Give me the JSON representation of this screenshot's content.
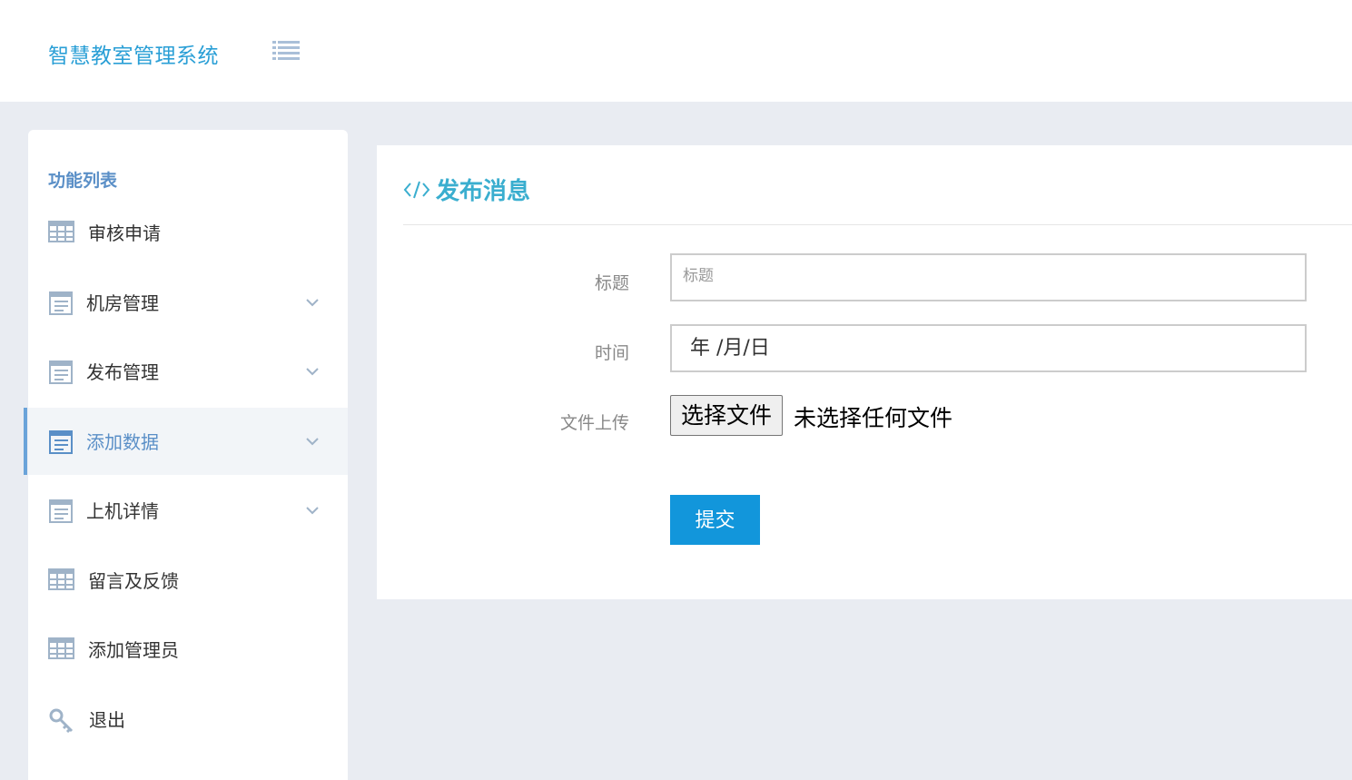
{
  "header": {
    "app_title": "智慧教室管理系统",
    "menu_toggle_icon": "list-icon"
  },
  "sidebar": {
    "heading": "功能列表",
    "items": [
      {
        "label": "审核申请",
        "icon": "table-grid-icon",
        "has_submenu": false,
        "active": false
      },
      {
        "label": "机房管理",
        "icon": "form-list-icon",
        "has_submenu": true,
        "active": false
      },
      {
        "label": "发布管理",
        "icon": "form-list-icon",
        "has_submenu": true,
        "active": false
      },
      {
        "label": "添加数据",
        "icon": "form-list-icon",
        "has_submenu": true,
        "active": true
      },
      {
        "label": "上机详情",
        "icon": "form-list-icon",
        "has_submenu": true,
        "active": false
      },
      {
        "label": "留言及反馈",
        "icon": "table-grid-icon",
        "has_submenu": false,
        "active": false
      },
      {
        "label": "添加管理员",
        "icon": "table-grid-icon",
        "has_submenu": false,
        "active": false
      },
      {
        "label": "退出",
        "icon": "key-icon",
        "has_submenu": false,
        "active": false
      }
    ]
  },
  "main": {
    "panel_title": "发布消息",
    "panel_icon": "code-icon",
    "form": {
      "title_label": "标题",
      "title_placeholder": "标题",
      "title_value": "",
      "time_label": "时间",
      "time_value": "年 /月/日",
      "file_label": "文件上传",
      "file_button_label": "选择文件",
      "file_status": "未选择任何文件",
      "submit_label": "提交"
    }
  },
  "colors": {
    "brand_blue": "#2a9fd6",
    "sidebar_accent": "#5a8fc7",
    "title_cyan": "#3aaecf",
    "submit_bg": "#1296db",
    "page_bg": "#e9ecf2"
  }
}
